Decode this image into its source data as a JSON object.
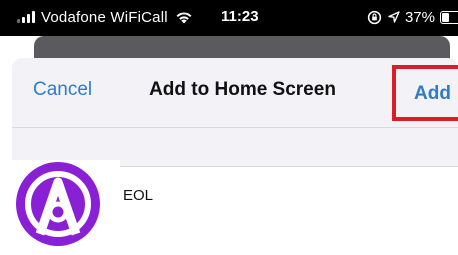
{
  "status_bar": {
    "carrier": "Vodafone WiFiCall",
    "time": "11:23",
    "battery": "37%",
    "battery_level": 0.37,
    "icons": [
      "signal-icon",
      "wifi-icon",
      "orientation-lock-icon",
      "location-icon",
      "battery-icon"
    ]
  },
  "nav": {
    "cancel_label": "Cancel",
    "title": "Add to Home Screen",
    "add_label": "Add"
  },
  "shortcut": {
    "name": "EOL",
    "icon": "app-logo-icon"
  },
  "colors": {
    "accent": "#2f7cc8",
    "highlight_box": "#d91e2a",
    "icon_purple": "#8a20d6",
    "sheet_bg": "#f2f2f7",
    "status_bg": "#000000"
  }
}
